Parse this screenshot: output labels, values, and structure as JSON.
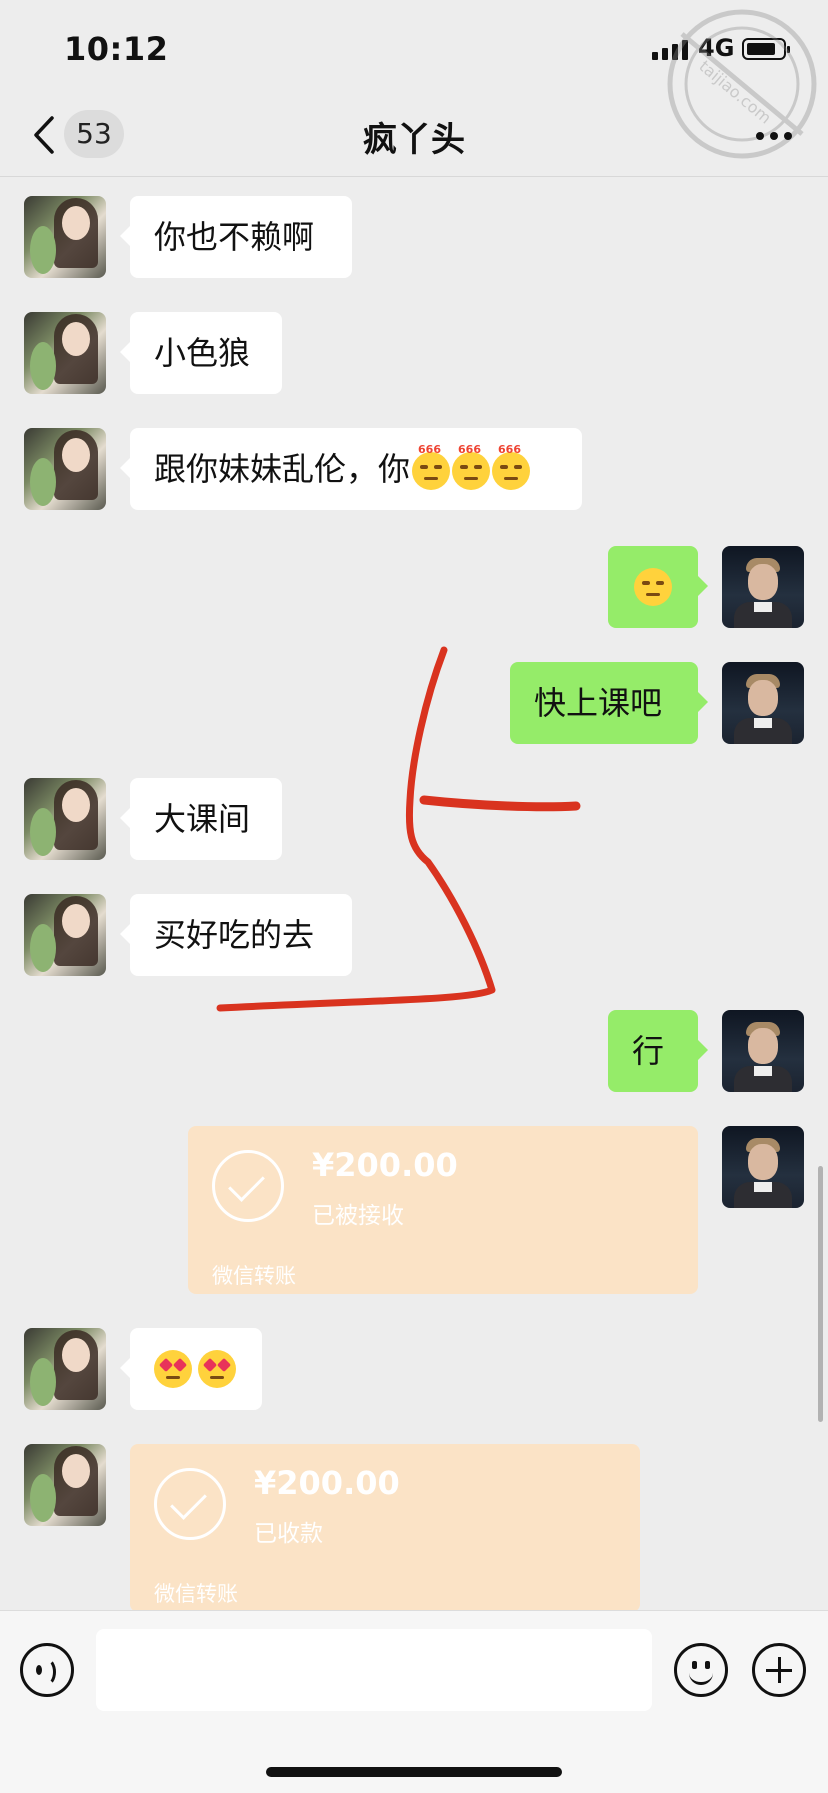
{
  "status_bar": {
    "time": "10:12",
    "network": "4G"
  },
  "nav": {
    "unread_count": "53",
    "title": "疯丫头"
  },
  "watermark": {
    "text": "taijiao.com"
  },
  "messages": [
    {
      "side": "in",
      "text": "你也不赖啊"
    },
    {
      "side": "in",
      "text": "小色狼"
    },
    {
      "side": "in",
      "text": "跟你妹妹乱伦，你",
      "emojis": [
        "666-emoji",
        "666-emoji",
        "666-emoji"
      ],
      "emoji_tag": "666"
    },
    {
      "side": "out",
      "text": "",
      "emojis": [
        "sweat-emoji"
      ]
    },
    {
      "side": "out",
      "text": "快上课吧"
    },
    {
      "side": "in",
      "text": "大课间"
    },
    {
      "side": "in",
      "text": "买好吃的去"
    },
    {
      "side": "out",
      "text": "行"
    },
    {
      "side": "out",
      "type": "transfer",
      "amount": "¥200.00",
      "status": "已被接收",
      "footer": "微信转账"
    },
    {
      "side": "in",
      "text": "",
      "emojis": [
        "heart-eyes-emoji",
        "heart-eyes-emoji"
      ]
    },
    {
      "side": "in",
      "type": "transfer",
      "amount": "¥200.00",
      "status": "已收款",
      "footer": "微信转账"
    }
  ],
  "colors": {
    "out_bubble": "#95ec69",
    "in_bubble": "#ffffff",
    "transfer_card": "#fbe3c6",
    "annotation": "#d9331f"
  }
}
